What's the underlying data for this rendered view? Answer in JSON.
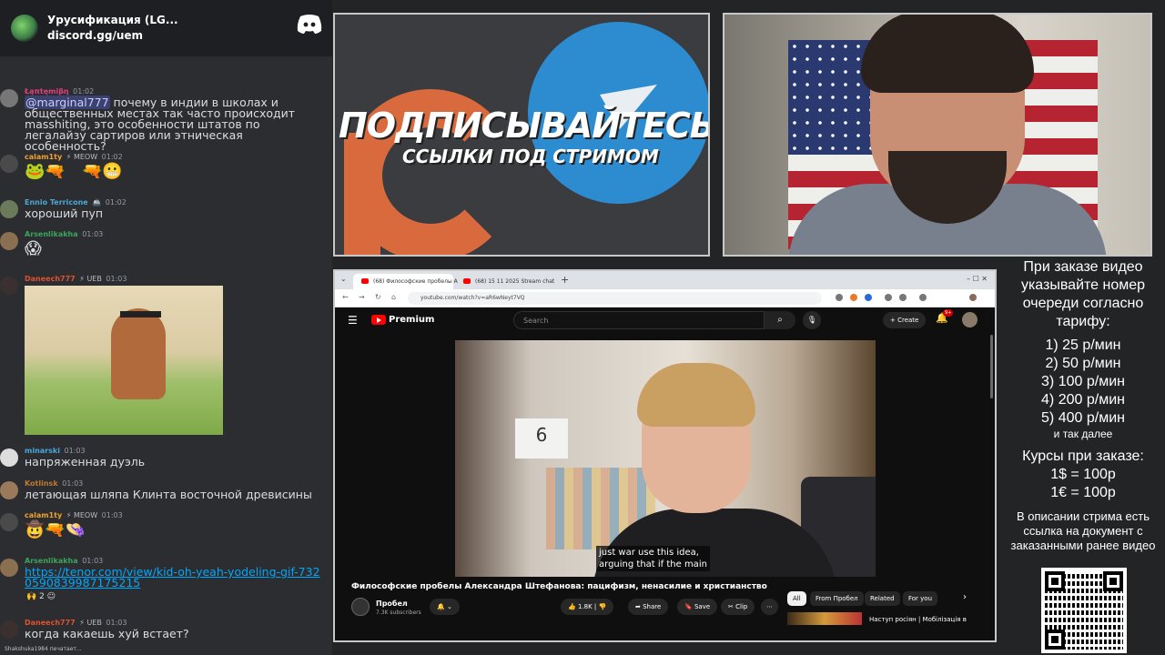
{
  "discord": {
    "server_name": "Урусификация (LG...",
    "invite": "discord.gg/uem",
    "typing": "Shakshuka1984 печатает..."
  },
  "messages": [
    {
      "name": "Łąπtęmiβη",
      "name_color": "#e0407a",
      "badge": "",
      "time": "01:02",
      "mention": "@marginal777",
      "text": " почему в индии в школах и общественных местах так часто происходит masshiting, это особенности штатов по легалайзу сартиров или этническая особенность?"
    },
    {
      "name": "calam1ty",
      "name_color": "#f0a030",
      "badge": "⚡ MEOW",
      "time": "01:02",
      "text": ""
    },
    {
      "name": "Ennio Terricone",
      "name_color": "#4aa8d8",
      "badge": "🚢",
      "time": "01:02",
      "text": "хороший пуп"
    },
    {
      "name": "Arsenlikakha",
      "name_color": "#3ba55c",
      "badge": "",
      "time": "01:03",
      "text": ""
    },
    {
      "name": "Daneech777",
      "name_color": "#e05030",
      "badge": "⚡ UEB",
      "time": "01:03",
      "text": ""
    },
    {
      "name": "minarski",
      "name_color": "#4aa8d8",
      "badge": "",
      "time": "01:03",
      "text": "напряженная дуэль"
    },
    {
      "name": "Kotlinsk",
      "name_color": "#c07a30",
      "badge": "",
      "time": "01:03",
      "text": "летающая шляпа Клинта восточной древисины"
    },
    {
      "name": "calam1ty",
      "name_color": "#f0a030",
      "badge": "⚡ MEOW",
      "time": "01:03",
      "text": ""
    },
    {
      "name": "Arsenlikakha",
      "name_color": "#3ba55c",
      "badge": "",
      "time": "01:03",
      "link": "https://tenor.com/view/kid-oh-yeah-yodeling-gif-7320590839987175215",
      "reactions": "2"
    },
    {
      "name": "Daneech777",
      "name_color": "#e05030",
      "badge": "⚡ UEB",
      "time": "01:03",
      "text": "когда какаешь хуй встает?"
    }
  ],
  "promo": {
    "line1": "ПОДПИСЫВАЙТЕСЬ",
    "line2": "ССЫЛКИ ПОД СТРИМОМ"
  },
  "browser": {
    "tab1": "(68) Философские пробелы А",
    "tab2": "(68) 15 11 2025 Stream chat",
    "url": "youtube.com/watch?v=aR6wNeyt7VQ"
  },
  "youtube": {
    "logo": "Premium",
    "search_placeholder": "Search",
    "create": "+ Create",
    "notif_count": "9+",
    "subtitle_line1": "just war use this idea,",
    "subtitle_line2": "arguing that if the main",
    "title": "Философские пробелы Александра Штефанова: пацифизм, ненасилие и христианство",
    "channel": "Пробел",
    "subscribers": "7.3K subscribers",
    "likes": "1.8K",
    "share": "Share",
    "save": "Save",
    "clip": "Clip",
    "chips": [
      "All",
      "From Пробел",
      "Related",
      "For you"
    ],
    "rec_title": "Наступ росіян | Мобілізація в",
    "calendar_day": "6"
  },
  "info": {
    "intro": "При заказе видео указывайте номер очереди согласно тарифу:",
    "tiers": [
      "1) 25 р/мин",
      "2) 50 р/мин",
      "3) 100 р/мин",
      "4) 200 р/мин",
      "5) 400 р/мин"
    ],
    "etc": "и так далее",
    "rates_title": "Курсы при заказе:",
    "rate1": "1$ = 100р",
    "rate2": "1€ = 100р",
    "note": "В описании стрима есть ссылка на документ с заказанными ранее видео"
  }
}
